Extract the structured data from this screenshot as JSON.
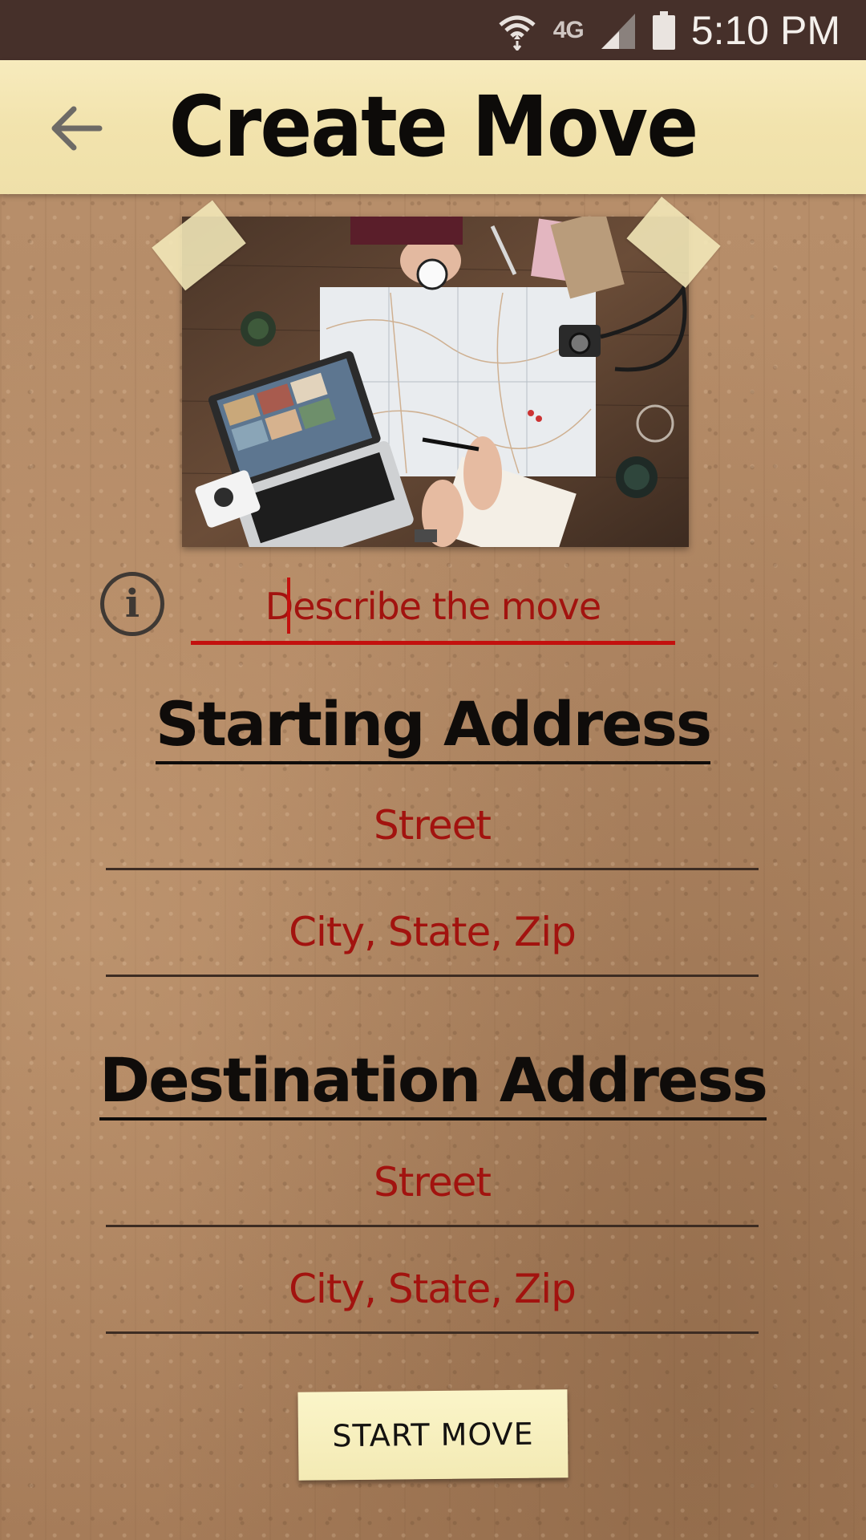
{
  "status_bar": {
    "network_label": "4G",
    "time": "5:10 PM",
    "icons": [
      "wifi-icon",
      "signal-icon",
      "battery-icon"
    ]
  },
  "header": {
    "title": "Create Move",
    "back_icon": "arrow-left-icon"
  },
  "photo": {
    "subject": "travel-planning-map-photo"
  },
  "describe": {
    "placeholder": "Describe the move",
    "info_icon": "info-icon"
  },
  "starting_address": {
    "title": "Starting Address",
    "street_placeholder": "Street",
    "city_placeholder": "City, State, Zip"
  },
  "destination_address": {
    "title": "Destination Address",
    "street_placeholder": "Street",
    "city_placeholder": "City, State, Zip"
  },
  "actions": {
    "start_label": "START MOVE"
  },
  "colors": {
    "status_bar": "#46302a",
    "header": "#f2e3ad",
    "placeholder_red": "#a2130f",
    "underline_red": "#c3110e",
    "cardboard": "#b48a66"
  }
}
